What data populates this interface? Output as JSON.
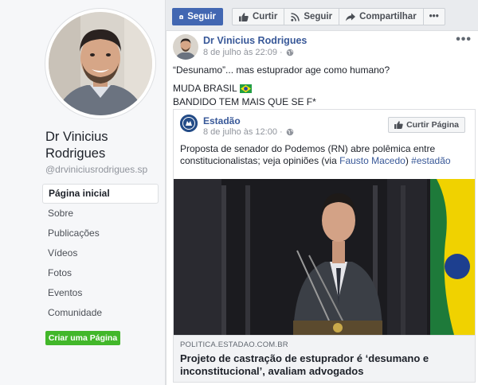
{
  "sidebar": {
    "page_name": "Dr Vinicius Rodrigues",
    "handle": "@drviniciusrodrigues.sp",
    "nav_items": [
      "Página inicial",
      "Sobre",
      "Publicações",
      "Vídeos",
      "Fotos",
      "Eventos",
      "Comunidade"
    ],
    "create_page": "Criar uma Página"
  },
  "actions": {
    "follow": "Seguir",
    "like": "Curtir",
    "follow2": "Seguir",
    "share": "Compartilhar",
    "more": "•••"
  },
  "post": {
    "author": "Dr Vinicius Rodrigues",
    "time": "8 de julho às 22:09 ·",
    "menu": "•••",
    "lines": [
      "“Desunamo”... mas estuprador age como humano?",
      "MUDA BRASIL",
      "BANDIDO TEM MAIS QUE SE F*"
    ]
  },
  "shared": {
    "source": "Estadão",
    "time": "8 de julho às 12:00 ·",
    "like_page": "Curtir Página",
    "text_before": "Proposta de senador do Podemos (RN) abre polêmica entre constitucionalistas; veja opiniões (via ",
    "mention": "Fausto Macedo",
    "text_mid": ") ",
    "hashtag": "#estadão",
    "link_domain": "POLITICA.ESTADAO.COM.BR",
    "headline": "Projeto de castração de estuprador é ‘desumano e inconstitucional’, avaliam advogados"
  },
  "colors": {
    "facebook_blue": "#4267b2",
    "link_blue": "#385898",
    "green": "#42b72a"
  },
  "icons": [
    "seguir-icon",
    "thumbs-up-icon",
    "rss-icon",
    "share-arrow-icon",
    "globe-icon",
    "brazil-flag-icon"
  ]
}
